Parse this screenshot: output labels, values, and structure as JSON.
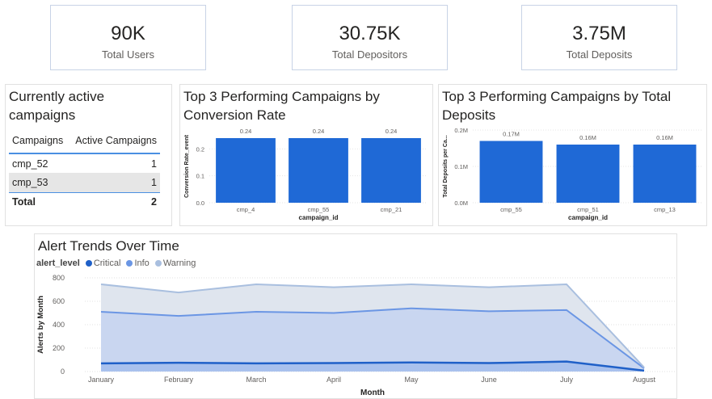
{
  "kpis": [
    {
      "value": "90K",
      "label": "Total Users"
    },
    {
      "value": "30.75K",
      "label": "Total Depositors"
    },
    {
      "value": "3.75M",
      "label": "Total Deposits"
    }
  ],
  "active_campaigns": {
    "title": "Currently active campaigns",
    "headers": [
      "Campaigns",
      "Active Campaigns"
    ],
    "rows": [
      [
        "cmp_52",
        "1"
      ],
      [
        "cmp_53",
        "1"
      ]
    ],
    "total_label": "Total",
    "total_value": "2"
  },
  "colors": {
    "bar": "#1f69d6",
    "critical": "#1f60c8",
    "info": "#6b96e4",
    "warning": "#a9bfdf"
  },
  "chart_data": [
    {
      "type": "bar",
      "title": "Top 3 Performing Campaigns by Conversion Rate",
      "xlabel": "campaign_id",
      "ylabel": "Conversion Rate_event",
      "categories": [
        "cmp_4",
        "cmp_55",
        "cmp_21"
      ],
      "values": [
        0.24,
        0.24,
        0.24
      ],
      "data_labels": [
        "0.24",
        "0.24",
        "0.24"
      ],
      "yticks": [
        0,
        0.1,
        0.2
      ],
      "ytick_labels": [
        "0.0",
        "0.1",
        "0.2"
      ],
      "ylim": [
        0,
        0.27
      ]
    },
    {
      "type": "bar",
      "title": "Top 3 Performing Campaigns by Total Deposits",
      "xlabel": "campaign_id",
      "ylabel": "Total Deposits per Ca...",
      "categories": [
        "cmp_55",
        "cmp_51",
        "cmp_13"
      ],
      "values": [
        170000,
        160000,
        160000
      ],
      "data_labels": [
        "0.17M",
        "0.16M",
        "0.16M"
      ],
      "yticks": [
        0,
        100000,
        200000
      ],
      "ytick_labels": [
        "0.0M",
        "0.1M",
        "0.2M"
      ],
      "ylim": [
        0,
        200000
      ]
    },
    {
      "type": "area",
      "title": "Alert Trends Over Time",
      "xlabel": "Month",
      "ylabel": "Alerts by Month",
      "legend_title": "alert_level",
      "categories": [
        "January",
        "February",
        "March",
        "April",
        "May",
        "June",
        "July",
        "August"
      ],
      "series": [
        {
          "name": "Critical",
          "values": [
            70,
            75,
            70,
            72,
            78,
            72,
            85,
            8
          ]
        },
        {
          "name": "Info",
          "values": [
            510,
            475,
            510,
            500,
            540,
            515,
            525,
            28
          ]
        },
        {
          "name": "Warning",
          "values": [
            745,
            675,
            745,
            720,
            745,
            720,
            745,
            35
          ]
        }
      ],
      "yticks": [
        0,
        200,
        400,
        600,
        800
      ],
      "ylim": [
        0,
        800
      ]
    }
  ]
}
